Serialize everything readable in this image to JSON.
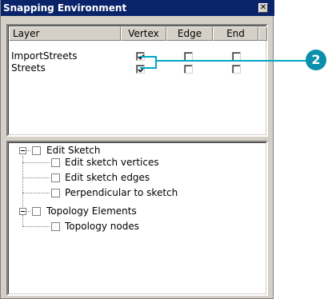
{
  "window": {
    "title": "Snapping Environment",
    "close_glyph": "✕"
  },
  "table": {
    "columns": [
      "Layer",
      "Vertex",
      "Edge",
      "End"
    ],
    "rows": [
      {
        "layer": "ImportStreets",
        "vertex": true,
        "edge": false,
        "end": false
      },
      {
        "layer": "Streets",
        "vertex": true,
        "edge": false,
        "end": false
      }
    ]
  },
  "tree": {
    "groups": [
      {
        "label": "Edit Sketch",
        "expanded": true,
        "checked": false,
        "children": [
          {
            "label": "Edit sketch vertices",
            "checked": false
          },
          {
            "label": "Edit sketch edges",
            "checked": false
          },
          {
            "label": "Perpendicular to sketch",
            "checked": false
          }
        ]
      },
      {
        "label": "Topology Elements",
        "expanded": true,
        "checked": false,
        "children": [
          {
            "label": "Topology nodes",
            "checked": false
          }
        ]
      }
    ]
  },
  "callout": {
    "number": "2",
    "color": "#0b8faa"
  }
}
